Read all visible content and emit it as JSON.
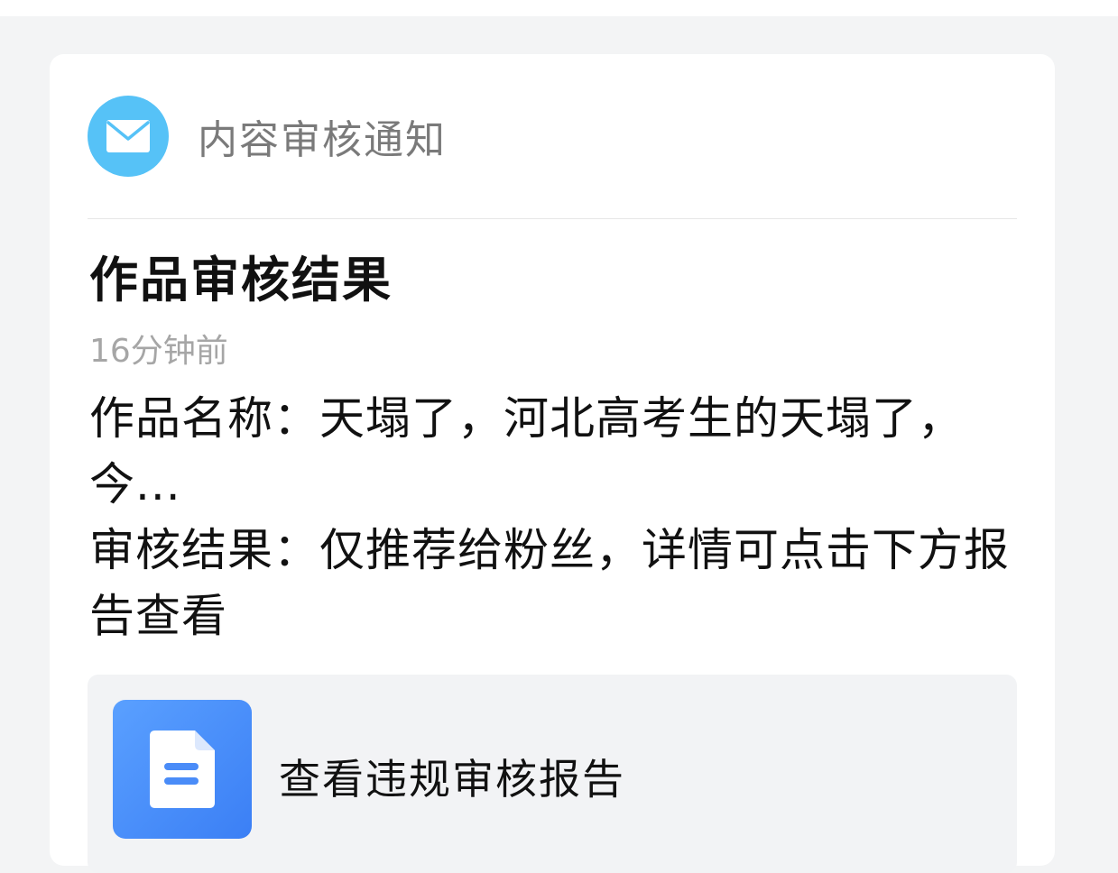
{
  "header": {
    "title": "内容审核通知",
    "icon": "mail-icon",
    "icon_color": "#56c2f7"
  },
  "notice": {
    "title": "作品审核结果",
    "timestamp": "16分钟前",
    "work_name_line": "作品名称：天塌了，河北高考生的天塌了，今...",
    "result_line": "审核结果：仅推荐给粉丝，详情可点击下方报告查看"
  },
  "report": {
    "label": "查看违规审核报告",
    "icon": "document-icon",
    "icon_color": "#4a8cf8"
  }
}
